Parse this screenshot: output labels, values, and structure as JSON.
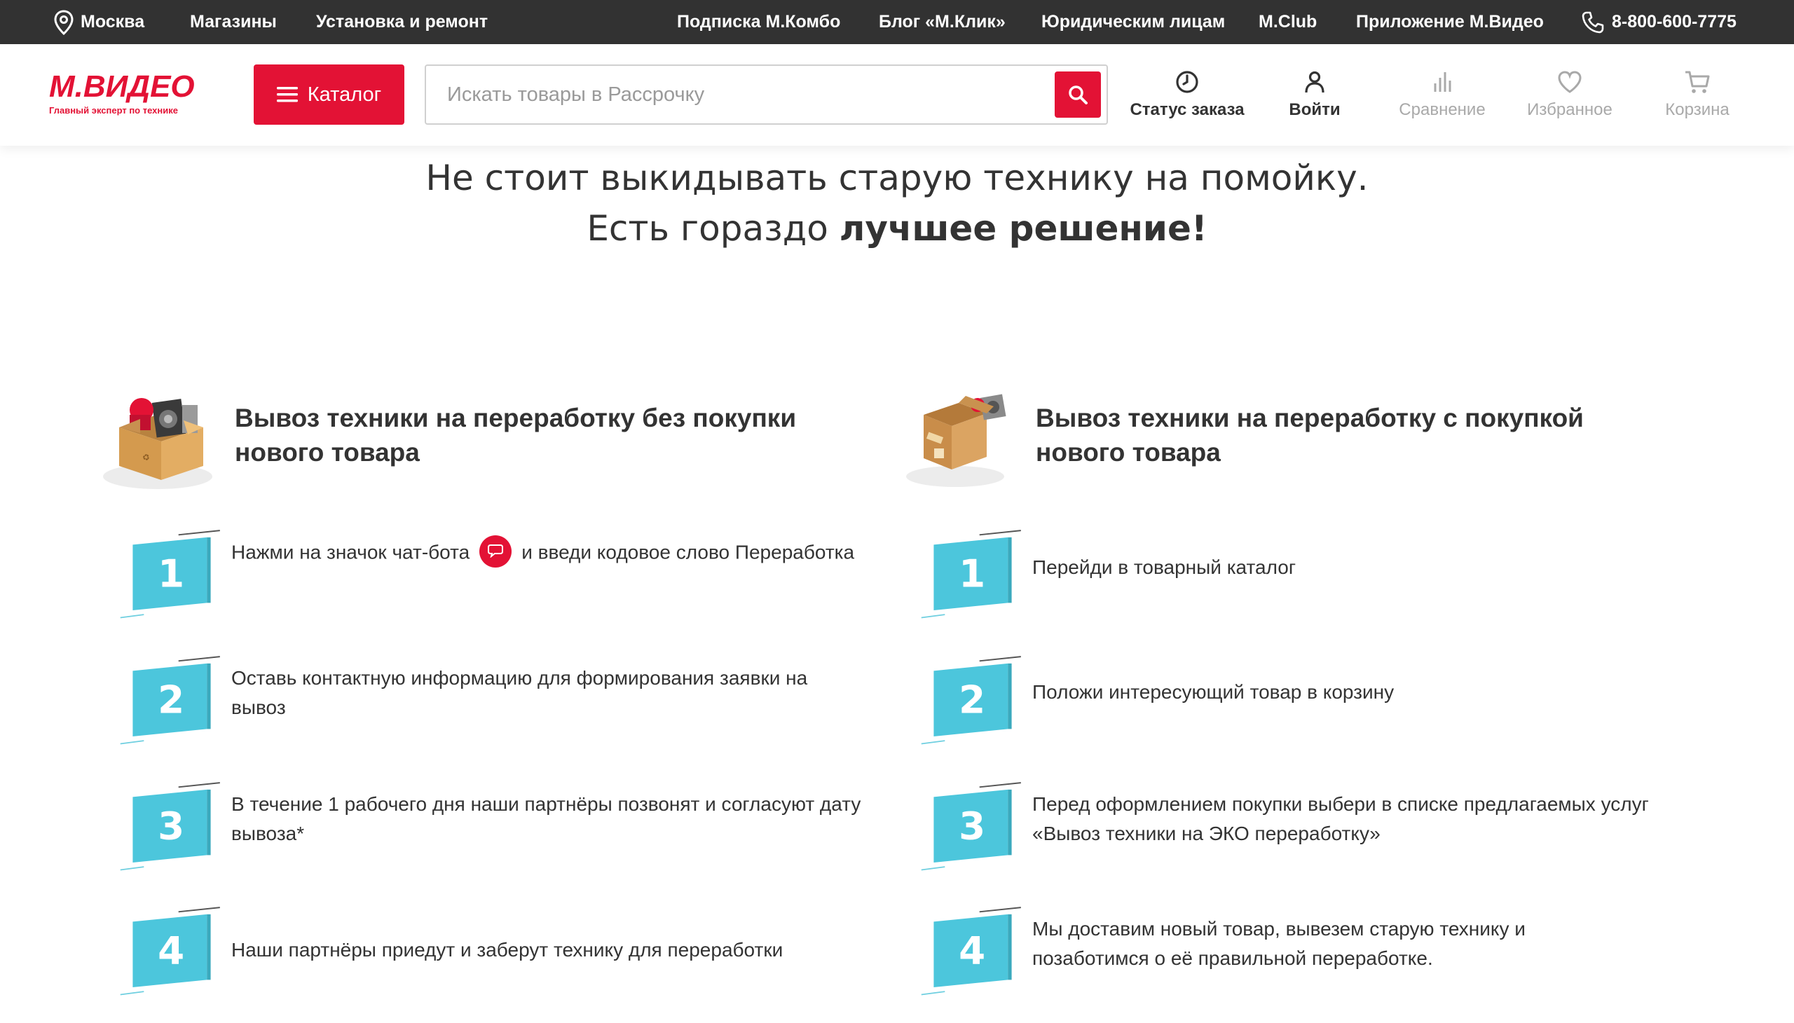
{
  "colors": {
    "brand_red": "#e31235",
    "topbar_bg": "#323232",
    "step_blue": "#4cc6dc"
  },
  "topbar": {
    "city": "Москва",
    "stores": "Магазины",
    "install": "Установка и ремонт",
    "subscription": "Подписка М.Комбо",
    "blog": "Блог «М.Клик»",
    "legal": "Юридическим лицам",
    "club": "M.Club",
    "app": "Приложение М.Видео",
    "phone": "8-800-600-7775"
  },
  "header": {
    "logo_text": "М.ВИДЕО",
    "logo_tagline": "Главный эксперт по технике",
    "catalog_label": "Каталог",
    "search_placeholder": "Искать товары в Рассрочку",
    "actions": {
      "order_status": "Статус заказа",
      "login": "Войти",
      "compare": "Сравнение",
      "favorites": "Избранное",
      "cart": "Корзина"
    }
  },
  "hero": {
    "line1": "Не стоит выкидывать старую технику на помойку.",
    "line2_regular": "Есть гораздо ",
    "line2_bold": "лучшее решение!"
  },
  "left_column": {
    "title": "Вывоз техники на переработку без покупки нового товара",
    "steps": [
      {
        "number": "1",
        "text_before": "Нажми на значок чат-бота",
        "text_after": "и введи кодовое слово Переработка"
      },
      {
        "number": "2",
        "text": "Оставь контактную информацию для формирования заявки на вывоз"
      },
      {
        "number": "3",
        "text": "В течение 1 рабочего дня наши партнёры позвонят и согласуют дату вывоза*"
      },
      {
        "number": "4",
        "text": "Наши партнёры приедут и заберут технику для переработки"
      }
    ]
  },
  "right_column": {
    "title": "Вывоз техники на переработку с покупкой нового товара",
    "steps": [
      {
        "number": "1",
        "text": "Перейди в товарный каталог"
      },
      {
        "number": "2",
        "text": "Положи интересующий товар в корзину"
      },
      {
        "number": "3",
        "text": "Перед оформлением покупки выбери в списке предлагаемых услуг «Вывоз техники на ЭКО переработку»"
      },
      {
        "number": "4",
        "text": "Мы доставим новый товар, вывезем старую технику и позаботимся о её правильной переработке."
      }
    ]
  }
}
